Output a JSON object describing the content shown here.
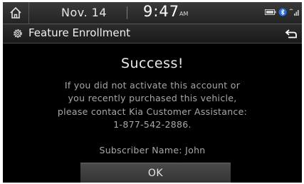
{
  "status_bar": {
    "date": "Nov. 14",
    "time": "9:47",
    "ampm": "AM"
  },
  "title_bar": {
    "title": "Feature Enrollment"
  },
  "dialog": {
    "heading": "Success!",
    "message_lines": [
      "If you did not activate this account or",
      "you recently purchased this vehicle,",
      "please contact Kia Customer Assistance:",
      "1-877-542-2886."
    ],
    "subscriber": "Subscriber Name: John",
    "ok_label": "OK"
  },
  "icons": {
    "home": "home-icon",
    "settings": "gear-icon",
    "back": "back-arrow-icon",
    "battery": "battery-icon",
    "bluetooth": "bluetooth-icon",
    "signal": "signal-icon"
  }
}
